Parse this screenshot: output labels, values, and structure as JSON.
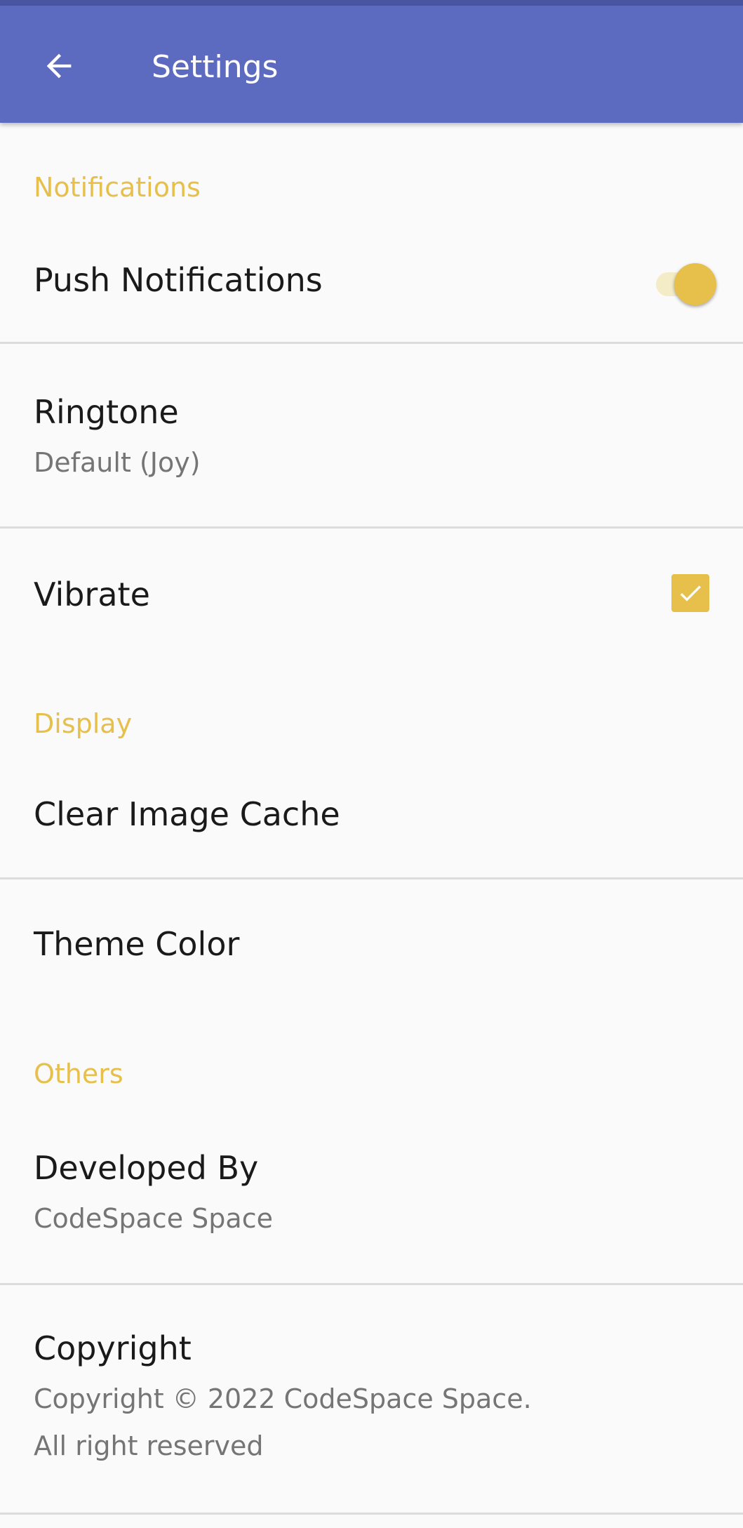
{
  "app_bar": {
    "title": "Settings",
    "back_icon": "arrow-left-icon",
    "color": "#5c6bc0"
  },
  "accent_color": "#e6c04b",
  "sections": {
    "notifications": {
      "header": "Notifications",
      "push": {
        "title": "Push Notifications",
        "enabled": true
      },
      "ringtone": {
        "title": "Ringtone",
        "summary": "Default (Joy)"
      },
      "vibrate": {
        "title": "Vibrate",
        "checked": true
      }
    },
    "display": {
      "header": "Display",
      "clear_cache": {
        "title": "Clear Image Cache"
      },
      "theme_color": {
        "title": "Theme Color"
      }
    },
    "others": {
      "header": "Others",
      "developed_by": {
        "title": "Developed By",
        "summary": "CodeSpace Space"
      },
      "copyright": {
        "title": "Copyright",
        "summary_line1": "Copyright © 2022 CodeSpace Space.",
        "summary_line2": "All right reserved"
      }
    }
  }
}
